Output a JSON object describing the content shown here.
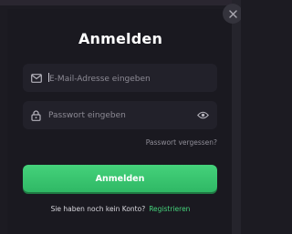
{
  "modal": {
    "title": "Anmelden",
    "close_icon": "close-icon"
  },
  "email": {
    "icon": "mail-icon",
    "placeholder": "E-Mail-Adresse eingeben"
  },
  "password": {
    "icon": "lock-icon",
    "placeholder": "Passwort eingeben",
    "toggle_icon": "eye-icon"
  },
  "forgot_label": "Passwort vergessen?",
  "login_button": "Anmelden",
  "signup": {
    "prompt": "Sie haben noch kein Konto?",
    "link": "Registrieren"
  },
  "colors": {
    "accent": "#45d27b",
    "background": "#1a1920",
    "field": "#22212a"
  }
}
